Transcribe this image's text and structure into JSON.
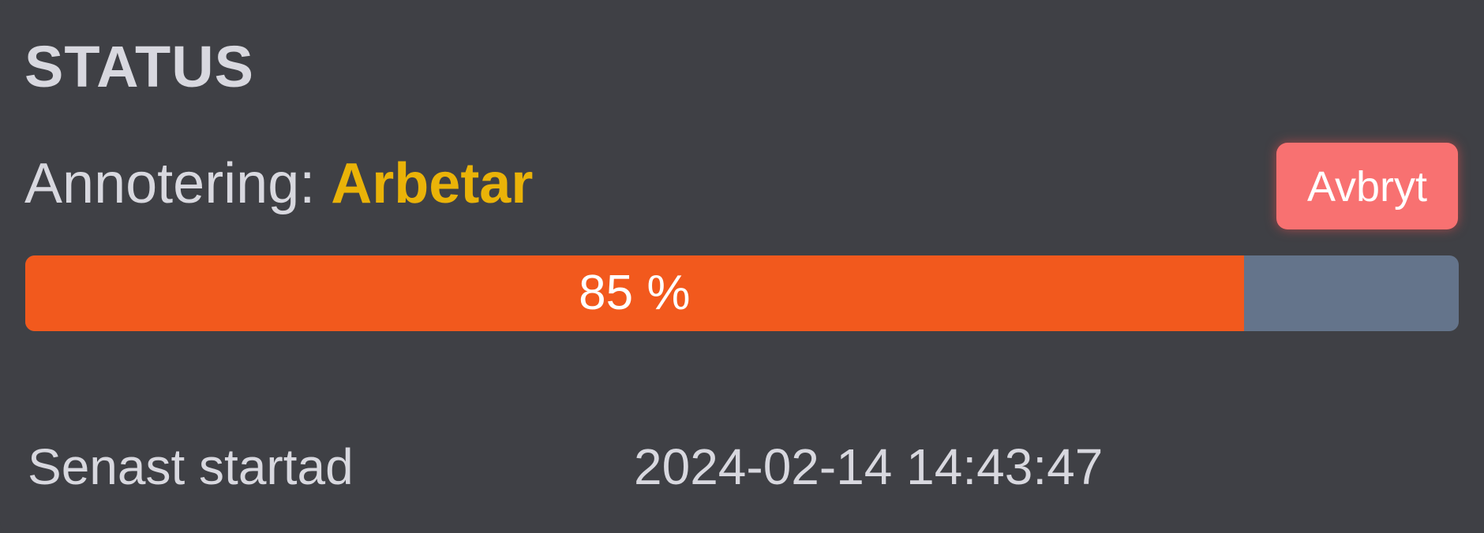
{
  "panel": {
    "title": "STATUS"
  },
  "annotation": {
    "label": "Annotering:",
    "state": "Arbetar",
    "state_color": "#eab308"
  },
  "actions": {
    "cancel_label": "Avbryt",
    "cancel_color": "#f87171"
  },
  "progress": {
    "value": 0.85,
    "label": "85 %",
    "fill_color": "#f2591d",
    "track_color": "#64748b"
  },
  "meta": {
    "last_started_label": "Senast startad",
    "last_started_value": "2024-02-14 14:43:47"
  }
}
